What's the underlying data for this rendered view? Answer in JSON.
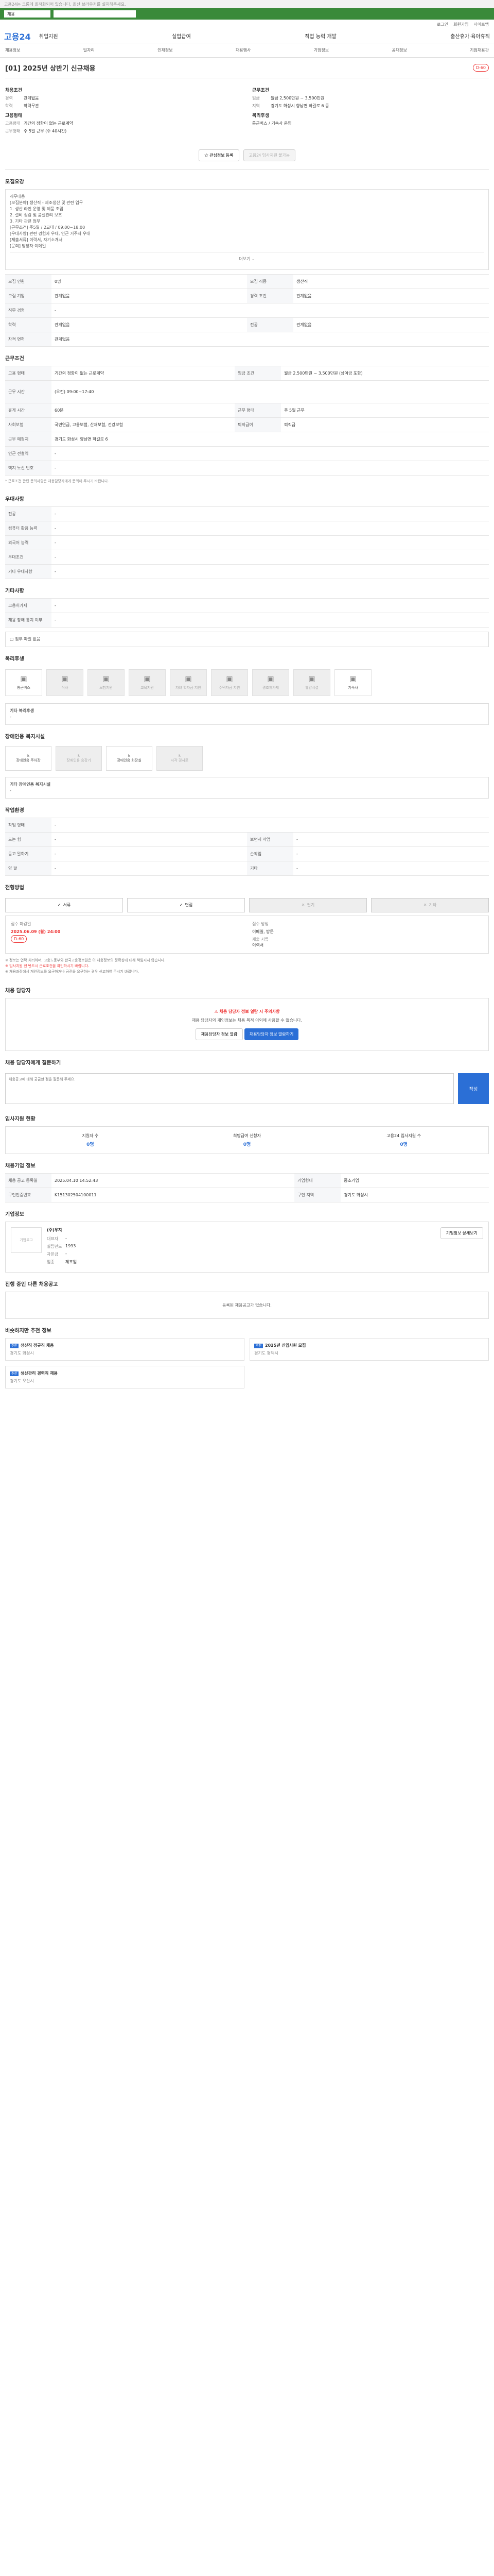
{
  "topbar": {
    "text": "고용24는 크롬에 최적화되어 있습니다. 최신 브라우저를 설치해주세요."
  },
  "header": {
    "select_label": "채용",
    "search_placeholder": "",
    "util": [
      "로그인",
      "회원가입",
      "사이트맵"
    ],
    "logo": "고용24",
    "gnb": [
      "취업지원",
      "실업급여",
      "직업 능력 개발",
      "출산휴가·육아휴직"
    ],
    "subnav": [
      "채용정보",
      "일자리",
      "인재정보",
      "채용행사",
      "기업정보",
      "공채정보",
      "기업채용관"
    ]
  },
  "job": {
    "title": "[01] 2025년 상반기 신규채용",
    "dday": "D-60",
    "summary_left": {
      "h": "채용조건",
      "rows": [
        {
          "k": "경력",
          "v": "관계없음"
        },
        {
          "k": "학력",
          "v": "학력무관"
        }
      ]
    },
    "summary_right": {
      "h": "근무조건",
      "rows": [
        {
          "k": "임금",
          "v": "월급 2,500만원 ~ 3,500만원"
        },
        {
          "k": "지역",
          "v": "경기도 화성시 향남면 하길로 6 등"
        }
      ]
    },
    "summary_left2": {
      "h": "고용형태",
      "rows": [
        {
          "k": "고용형태",
          "v": "기간의 정함이 없는 근로계약"
        },
        {
          "k": "근무형태",
          "v": "주 5일 근무 (주 40시간)"
        }
      ]
    },
    "summary_right2": {
      "h": "복리후생",
      "rows": [
        {
          "k": "",
          "v": "통근버스 / 기숙사 운영"
        }
      ]
    },
    "btn_scrap": "관심정보 등록",
    "btn_apply": "고용24 입사지원 불가능"
  },
  "recruit": {
    "title": "모집요강",
    "content": "직무내용\n[모집분야] 생산직 - 제조생산 및 관련 업무\n1. 생산 라인 운영 및 제품 조립\n2. 설비 점검 및 품질관리 보조\n3. 기타 관련 업무\n[근무조건] 주5일 / 2교대 / 09:00~18:00\n[우대사항] 관련 경험자 우대, 인근 거주자 우대\n[제출서류] 이력서, 자기소개서\n[문의] 담당자 이메일",
    "more": "더보기",
    "rows": [
      [
        {
          "k": "모집 인원",
          "v": "0명"
        },
        {
          "k": "모집 직종",
          "v": "생산직"
        }
      ],
      [
        {
          "k": "모집 기업",
          "v": "관계없음"
        },
        {
          "k": "경력 조건",
          "v": "관계없음"
        }
      ],
      [
        {
          "k": "직무 경험",
          "v": "-"
        },
        {
          "k": "",
          "v": ""
        }
      ],
      [
        {
          "k": "학력",
          "v": "관계없음"
        },
        {
          "k": "전공",
          "v": "관계없음"
        }
      ],
      [
        {
          "k": "자격 면허",
          "v": "관계없음"
        },
        {
          "k": "",
          "v": ""
        }
      ]
    ]
  },
  "work": {
    "title": "근무조건",
    "rows": [
      [
        {
          "k": "고용 형태",
          "v": "기간의 정함이 없는 근로계약"
        },
        {
          "k": "임금 조건",
          "v": "월급 2,500만원 ~ 3,500만원 (상여금 포함)"
        }
      ],
      [
        {
          "k": "근무 시간",
          "v": "(오전) 09:00~17:40"
        },
        {
          "k": "",
          "v": ""
        }
      ],
      [
        {
          "k": "휴게 시간",
          "v": "60분"
        },
        {
          "k": "근무 형태",
          "v": "주 5일 근무"
        }
      ],
      [
        {
          "k": "사회보험",
          "v": "국민연금, 고용보험, 산재보험, 건강보험"
        },
        {
          "k": "퇴직급여",
          "v": "퇴직금"
        }
      ],
      [
        {
          "k": "근무 예정지",
          "v": "경기도 화성시 향남면 하길로 6"
        },
        {
          "k": "",
          "v": ""
        }
      ],
      [
        {
          "k": "인근 전철역",
          "v": "-"
        },
        {
          "k": "",
          "v": ""
        }
      ],
      [
        {
          "k": "택지 노선 번호",
          "v": "-"
        },
        {
          "k": "",
          "v": ""
        }
      ]
    ],
    "note": "* 근로조건 관련 문의사항은 채용담당자에게 문의해 주시기 바랍니다."
  },
  "pref": {
    "title": "우대사항",
    "rows": [
      {
        "k": "전공",
        "v": "-"
      },
      {
        "k": "컴퓨터 활용 능력",
        "v": "-"
      },
      {
        "k": "외국어 능력",
        "v": "-"
      },
      {
        "k": "우대조건",
        "v": "-"
      },
      {
        "k": "기타 우대사항",
        "v": "-"
      }
    ]
  },
  "etc": {
    "title": "기타사항",
    "rows": [
      {
        "k": "고용허가제",
        "v": "-"
      },
      {
        "k": "채용 장애 통지 여부",
        "v": "-"
      }
    ],
    "file_label": "첨부 파일 없음"
  },
  "welfare": {
    "title": "복리후생",
    "cards": [
      {
        "label": "통근버스",
        "on": true
      },
      {
        "label": "식사",
        "on": false
      },
      {
        "label": "보험지원",
        "on": false
      },
      {
        "label": "교육지원",
        "on": false
      },
      {
        "label": "자녀 학자금 지원",
        "on": false
      },
      {
        "label": "주택자금 지원",
        "on": false
      },
      {
        "label": "경조휴가제",
        "on": false
      },
      {
        "label": "휴양시설",
        "on": false
      },
      {
        "label": "기숙사",
        "on": true
      }
    ],
    "etc_label": "기타 복리후생",
    "etc_value": "-"
  },
  "disability": {
    "title": "장애인용 복지시설",
    "cards": [
      {
        "label": "장애인용 주차장",
        "on": true
      },
      {
        "label": "장애인용 승강기",
        "on": false
      },
      {
        "label": "장애인용 화장실",
        "on": true
      },
      {
        "label": "시각 경사로",
        "on": false
      }
    ],
    "etc_label": "기타 장애인용 복지시설",
    "etc_value": "-"
  },
  "worksite": {
    "title": "작업환경",
    "rows": [
      [
        {
          "k": "작업 형태",
          "v": "-"
        },
        {
          "k": "",
          "v": ""
        }
      ],
      [
        {
          "k": "드는 힘",
          "v": "-"
        },
        {
          "k": "보면서 작업",
          "v": "-"
        }
      ],
      [
        {
          "k": "듣고 말하기",
          "v": "-"
        },
        {
          "k": "손작업",
          "v": "-"
        }
      ],
      [
        {
          "k": "양 팔",
          "v": "-"
        },
        {
          "k": "기타",
          "v": "-"
        }
      ]
    ]
  },
  "process": {
    "title": "전형방법",
    "methods": [
      {
        "label": "서류",
        "on": true
      },
      {
        "label": "면접",
        "on": true
      },
      {
        "label": "필기",
        "on": false
      },
      {
        "label": "기타",
        "on": false
      }
    ],
    "period_label": "접수 마감일",
    "period_value": "2025.06.09 (월) 24:00",
    "period_dday": "D-60",
    "method_label": "접수 방법",
    "method_value": "이메일, 방문",
    "docs_label": "제출 서류",
    "docs_value": "이력서"
  },
  "notices": [
    "※ 정보는 연락 처리하며, 고용노동부와 한국고용정보원은 이 채용정보의 정확성에 대해 책임지지 않습니다.",
    "※ 입사지원 전 반드시 근로조건을 확인하시기 바랍니다.",
    "※ 채용과정에서 개인정보를 요구하거나 금전을 요구하는 경우 신고하여 주시기 바랍니다."
  ],
  "contact": {
    "title": "채용 담당자",
    "warn": "채용 담당자 정보 열람 시 주의사항",
    "desc": "채용 담당자의 개인정보는 채용 목적 이외에 사용할 수 없습니다.",
    "btn1": "채용담당자 정보 열람",
    "btn2": "채용담당자 정보 열람하기"
  },
  "qna": {
    "title": "채용 담당자에게 질문하기",
    "placeholder": "채용공고에 대해 궁금한 점을 질문해 주세요.",
    "btn": "작성"
  },
  "stats": {
    "title": "입사지원 현황",
    "items": [
      {
        "label": "지원자 수",
        "value": "0명"
      },
      {
        "label": "희망급여 신청자",
        "value": "0명"
      },
      {
        "label": "고용24 입사지원 수",
        "value": "0명"
      }
    ]
  },
  "info": {
    "title": "채용기업 정보",
    "rows": [
      [
        {
          "k": "채용 공고 등록일",
          "v": "2025.04.10 14:52:43"
        },
        {
          "k": "기업형태",
          "v": "중소기업"
        }
      ],
      [
        {
          "k": "구인인증번호",
          "v": "K151302504100011"
        },
        {
          "k": "구인 지역",
          "v": "경기도 화성시"
        }
      ]
    ]
  },
  "company": {
    "title": "기업정보",
    "logo_text": "기업로고",
    "name": "(주)우지",
    "rows": [
      {
        "k": "대표자",
        "v": "-"
      },
      {
        "k": "설립년도",
        "v": "1993"
      },
      {
        "k": "자본금",
        "v": "-"
      },
      {
        "k": "업종",
        "v": "제조업"
      }
    ],
    "btn": "기업정보 상세보기"
  },
  "related": {
    "title": "진행 중인 다른 채용공고",
    "empty": "등록된 채용공고가 없습니다."
  },
  "similar": {
    "title": "비슷하지만 추천 정보",
    "cards": [
      {
        "badge": "추천",
        "title": "생산직 정규직 채용",
        "sub": "경기도 화성시"
      },
      {
        "badge": "추천",
        "title": "2025년 신입사원 모집",
        "sub": "경기도 평택시"
      },
      {
        "badge": "추천",
        "title": "생산관리 경력직 채용",
        "sub": "경기도 오산시"
      }
    ]
  }
}
